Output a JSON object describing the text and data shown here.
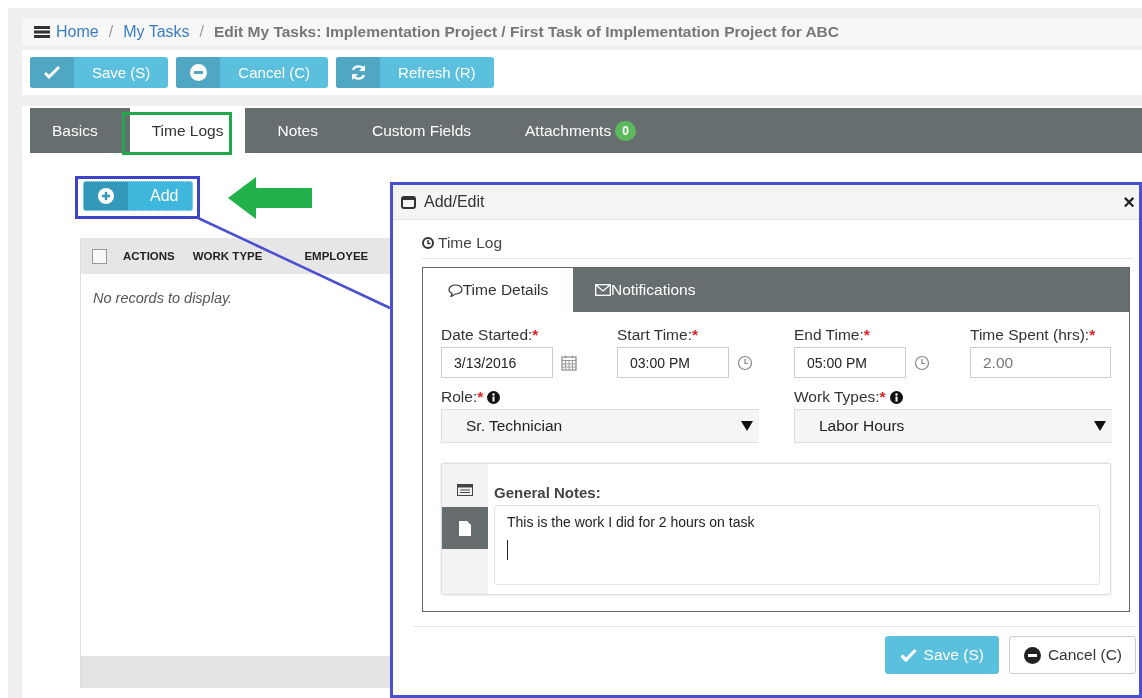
{
  "breadcrumb": {
    "links": [
      "Home",
      "My Tasks"
    ],
    "separator": "/",
    "current": "Edit My Tasks: Implementation Project / First Task of Implementation Project for ABC"
  },
  "toolbar": [
    {
      "label": "Save (S)",
      "kind": "save"
    },
    {
      "label": "Cancel (C)",
      "kind": "cancel"
    },
    {
      "label": "Refresh (R)",
      "kind": "refresh"
    }
  ],
  "tabs": [
    {
      "label": "Basics",
      "selected": false
    },
    {
      "label": "Time Logs",
      "selected": true
    },
    {
      "label": "Notes",
      "selected": false
    },
    {
      "label": "Custom Fields",
      "selected": false
    },
    {
      "label": "Attachments",
      "selected": false,
      "badge": "0"
    }
  ],
  "add_button": {
    "label": "Add"
  },
  "grid": {
    "select_all": {
      "checked": false
    },
    "columns": [
      "ACTIONS",
      "WORK TYPE",
      "EMPLOYEE"
    ],
    "empty_message": "No records to display."
  },
  "dialog": {
    "title": "Add/Edit",
    "close": "×",
    "section": "Time Log",
    "tabs": [
      {
        "label": "Time Details",
        "kind": "details",
        "selected": true
      },
      {
        "label": "Notifications",
        "kind": "notifications",
        "selected": false
      }
    ],
    "fields": [
      {
        "label": "Date Started:",
        "required_mark": "*",
        "value": "3/13/2016",
        "kind": "date"
      },
      {
        "label": "Start Time:",
        "required_mark": "*",
        "value": "03:00 PM",
        "kind": "time"
      },
      {
        "label": "End Time:",
        "required_mark": "*",
        "value": "05:00 PM",
        "kind": "time"
      },
      {
        "label": "Time Spent (hrs):",
        "required_mark": "*",
        "value": "2.00",
        "kind": "number"
      }
    ],
    "selects": [
      {
        "label": "Role:",
        "required_mark": "*",
        "value": "Sr. Technician"
      },
      {
        "label": "Work Types:",
        "required_mark": "*",
        "value": "Labor Hours"
      }
    ],
    "notes": {
      "label": "General Notes:",
      "value": "This is the work I did for 2 hours on task"
    },
    "buttons": [
      {
        "label": "Save (S)",
        "kind": "primary"
      },
      {
        "label": "Cancel (C)",
        "kind": "default"
      }
    ]
  }
}
